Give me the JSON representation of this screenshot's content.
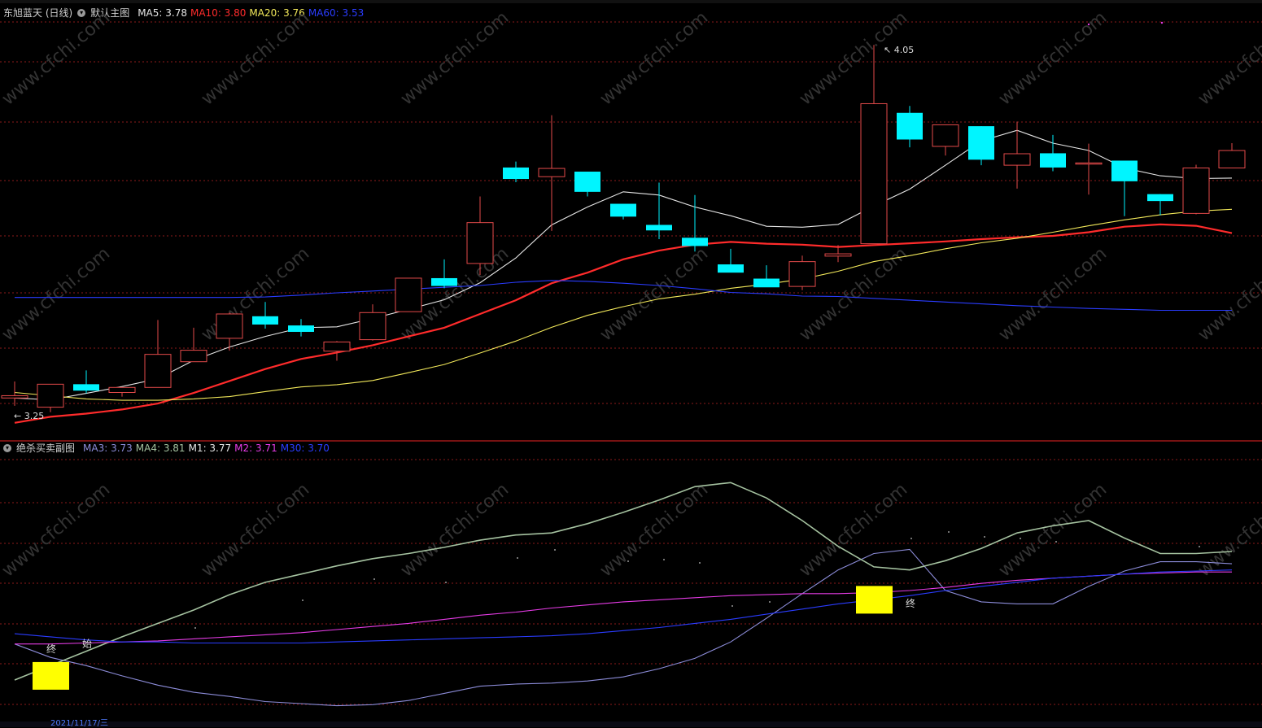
{
  "main_panel": {
    "title": "东旭蓝天 (日线)",
    "indicator_name": "默认主图",
    "legend": [
      {
        "label": "MA5:",
        "value": "3.78",
        "color": "#e6e6e6"
      },
      {
        "label": "MA10:",
        "value": "3.80",
        "color": "#ff2b2b"
      },
      {
        "label": "MA20:",
        "value": "3.76",
        "color": "#f2e85a"
      },
      {
        "label": "MA60:",
        "value": "3.53",
        "color": "#2a3cff"
      }
    ],
    "high_label": "4.05",
    "low_label": "3.25"
  },
  "sub_panel": {
    "indicator_name": "绝杀买卖副图",
    "legend": [
      {
        "label": "MA3:",
        "value": "3.73",
        "color": "#8c8cd9"
      },
      {
        "label": "MA4:",
        "value": "3.81",
        "color": "#a5c2a0"
      },
      {
        "label": "M1:",
        "value": "3.77",
        "color": "#e6e6e6"
      },
      {
        "label": "M2:",
        "value": "3.71",
        "color": "#e53be5"
      },
      {
        "label": "M30:",
        "value": "3.70",
        "color": "#2a3cff"
      }
    ],
    "markers": [
      {
        "text": "终",
        "x": 1,
        "y": 3.665
      },
      {
        "text": "始",
        "x": 2,
        "y": 3.67
      },
      {
        "text": "终",
        "x": 25,
        "y": 3.709
      }
    ]
  },
  "bottom_bar": {
    "date_label": "2021/11/17/三"
  },
  "watermark": "www.cfchi.com",
  "colors": {
    "up": "#e34a4a",
    "down": "#00f5ff",
    "grid": "#8b1a1a",
    "signal": "#ffff00"
  },
  "chart_data": [
    {
      "type": "candlestick",
      "title": "东旭蓝天 (日线)",
      "ylim": [
        3.2,
        4.1
      ],
      "candles": [
        {
          "o": 3.281,
          "h": 3.317,
          "l": 3.264,
          "c": 3.286
        },
        {
          "o": 3.261,
          "h": 3.311,
          "l": 3.25,
          "c": 3.311
        },
        {
          "o": 3.311,
          "h": 3.341,
          "l": 3.291,
          "c": 3.297
        },
        {
          "o": 3.293,
          "h": 3.304,
          "l": 3.284,
          "c": 3.304
        },
        {
          "o": 3.304,
          "h": 3.451,
          "l": 3.304,
          "c": 3.376
        },
        {
          "o": 3.36,
          "h": 3.434,
          "l": 3.36,
          "c": 3.385
        },
        {
          "o": 3.411,
          "h": 3.467,
          "l": 3.384,
          "c": 3.464
        },
        {
          "o": 3.459,
          "h": 3.49,
          "l": 3.432,
          "c": 3.441
        },
        {
          "o": 3.439,
          "h": 3.453,
          "l": 3.415,
          "c": 3.425
        },
        {
          "o": 3.383,
          "h": 3.405,
          "l": 3.362,
          "c": 3.403
        },
        {
          "o": 3.408,
          "h": 3.485,
          "l": 3.406,
          "c": 3.467
        },
        {
          "o": 3.469,
          "h": 3.542,
          "l": 3.469,
          "c": 3.542
        },
        {
          "o": 3.542,
          "h": 3.583,
          "l": 3.52,
          "c": 3.525
        },
        {
          "o": 3.574,
          "h": 3.72,
          "l": 3.549,
          "c": 3.663
        },
        {
          "o": 3.783,
          "h": 3.796,
          "l": 3.751,
          "c": 3.758
        },
        {
          "o": 3.763,
          "h": 3.897,
          "l": 3.645,
          "c": 3.781
        },
        {
          "o": 3.774,
          "h": 3.774,
          "l": 3.72,
          "c": 3.73
        },
        {
          "o": 3.704,
          "h": 3.704,
          "l": 3.67,
          "c": 3.676
        },
        {
          "o": 3.658,
          "h": 3.75,
          "l": 3.627,
          "c": 3.646
        },
        {
          "o": 3.63,
          "h": 3.723,
          "l": 3.6,
          "c": 3.612
        },
        {
          "o": 3.572,
          "h": 3.606,
          "l": 3.563,
          "c": 3.554
        },
        {
          "o": 3.541,
          "h": 3.57,
          "l": 3.525,
          "c": 3.522
        },
        {
          "o": 3.524,
          "h": 3.591,
          "l": 3.516,
          "c": 3.578
        },
        {
          "o": 3.59,
          "h": 3.614,
          "l": 3.577,
          "c": 3.595
        },
        {
          "o": 3.617,
          "h": 4.05,
          "l": 3.617,
          "c": 3.922
        },
        {
          "o": 3.902,
          "h": 3.917,
          "l": 3.827,
          "c": 3.844
        },
        {
          "o": 3.829,
          "h": 3.874,
          "l": 3.809,
          "c": 3.876
        },
        {
          "o": 3.873,
          "h": 3.873,
          "l": 3.788,
          "c": 3.8
        },
        {
          "o": 3.788,
          "h": 3.883,
          "l": 3.737,
          "c": 3.813
        },
        {
          "o": 3.814,
          "h": 3.854,
          "l": 3.775,
          "c": 3.783
        },
        {
          "o": 3.793,
          "h": 3.835,
          "l": 3.724,
          "c": 3.793
        },
        {
          "o": 3.798,
          "h": 3.798,
          "l": 3.677,
          "c": 3.753
        },
        {
          "o": 3.725,
          "h": 3.725,
          "l": 3.679,
          "c": 3.71
        },
        {
          "o": 3.683,
          "h": 3.789,
          "l": 3.681,
          "c": 3.782
        },
        {
          "o": 3.782,
          "h": 3.836,
          "l": 3.782,
          "c": 3.82
        }
      ],
      "series": [
        {
          "name": "MA5",
          "color": "#e6e6e6",
          "values": [
            3.281,
            3.277,
            3.291,
            3.306,
            3.323,
            3.363,
            3.392,
            3.415,
            3.434,
            3.436,
            3.454,
            3.474,
            3.495,
            3.532,
            3.586,
            3.658,
            3.697,
            3.73,
            3.723,
            3.697,
            3.678,
            3.655,
            3.653,
            3.659,
            3.699,
            3.736,
            3.788,
            3.841,
            3.864,
            3.836,
            3.82,
            3.782,
            3.765,
            3.759,
            3.76
          ]
        },
        {
          "name": "MA10",
          "color": "#ff2b2b",
          "values": [
            3.227,
            3.24,
            3.247,
            3.256,
            3.269,
            3.292,
            3.318,
            3.344,
            3.366,
            3.38,
            3.396,
            3.415,
            3.434,
            3.464,
            3.494,
            3.531,
            3.554,
            3.583,
            3.602,
            3.615,
            3.621,
            3.617,
            3.615,
            3.61,
            3.614,
            3.618,
            3.622,
            3.627,
            3.631,
            3.634,
            3.642,
            3.654,
            3.659,
            3.656,
            3.64
          ]
        },
        {
          "name": "MA20",
          "color": "#f2e85a",
          "values": [
            3.293,
            3.286,
            3.279,
            3.276,
            3.276,
            3.279,
            3.284,
            3.295,
            3.305,
            3.31,
            3.319,
            3.336,
            3.354,
            3.379,
            3.405,
            3.435,
            3.461,
            3.48,
            3.497,
            3.507,
            3.52,
            3.529,
            3.54,
            3.557,
            3.578,
            3.591,
            3.606,
            3.619,
            3.629,
            3.642,
            3.656,
            3.669,
            3.68,
            3.688,
            3.692
          ]
        },
        {
          "name": "MA60",
          "color": "#2a3cff",
          "values": [
            3.5,
            3.5,
            3.5,
            3.5,
            3.5,
            3.5,
            3.5,
            3.501,
            3.505,
            3.51,
            3.514,
            3.518,
            3.522,
            3.526,
            3.533,
            3.537,
            3.535,
            3.531,
            3.526,
            3.519,
            3.511,
            3.508,
            3.503,
            3.502,
            3.498,
            3.494,
            3.49,
            3.486,
            3.482,
            3.479,
            3.476,
            3.474,
            3.472,
            3.472,
            3.472
          ]
        }
      ]
    },
    {
      "type": "line",
      "title": "绝杀买卖副图",
      "ylim": [
        3.6,
        3.85
      ],
      "series": [
        {
          "name": "MA3",
          "color": "#8c8cd9",
          "values": [
            3.673,
            3.66,
            3.652,
            3.642,
            3.633,
            3.626,
            3.622,
            3.617,
            3.615,
            3.613,
            3.614,
            3.618,
            3.625,
            3.632,
            3.634,
            3.635,
            3.637,
            3.641,
            3.649,
            3.659,
            3.675,
            3.698,
            3.722,
            3.745,
            3.761,
            3.765,
            3.725,
            3.714,
            3.712,
            3.712,
            3.729,
            3.744,
            3.753,
            3.753,
            3.751
          ]
        },
        {
          "name": "MA4",
          "color": "#a5c2a0",
          "values": [
            3.638,
            3.652,
            3.666,
            3.68,
            3.693,
            3.706,
            3.721,
            3.733,
            3.741,
            3.749,
            3.756,
            3.761,
            3.767,
            3.774,
            3.779,
            3.781,
            3.79,
            3.801,
            3.813,
            3.826,
            3.83,
            3.815,
            3.793,
            3.768,
            3.748,
            3.745,
            3.754,
            3.766,
            3.781,
            3.788,
            3.793,
            3.776,
            3.761,
            3.761,
            3.763
          ]
        },
        {
          "name": "M1",
          "color": "#e6e6e6",
          "values": []
        },
        {
          "name": "M2",
          "color": "#e53be5",
          "values": [
            3.673,
            3.673,
            3.674,
            3.675,
            3.676,
            3.678,
            3.68,
            3.682,
            3.684,
            3.687,
            3.69,
            3.693,
            3.697,
            3.701,
            3.704,
            3.708,
            3.711,
            3.714,
            3.716,
            3.718,
            3.72,
            3.721,
            3.722,
            3.722,
            3.723,
            3.725,
            3.728,
            3.732,
            3.735,
            3.737,
            3.739,
            3.741,
            3.742,
            3.743,
            3.743
          ]
        },
        {
          "name": "M30",
          "color": "#2a3cff",
          "values": [
            3.683,
            3.68,
            3.677,
            3.675,
            3.675,
            3.674,
            3.674,
            3.674,
            3.674,
            3.675,
            3.676,
            3.677,
            3.678,
            3.679,
            3.68,
            3.681,
            3.683,
            3.686,
            3.689,
            3.693,
            3.697,
            3.702,
            3.707,
            3.712,
            3.716,
            3.72,
            3.725,
            3.729,
            3.733,
            3.737,
            3.739,
            3.741,
            3.743,
            3.744,
            3.745
          ]
        }
      ],
      "signals": [
        {
          "x": 1,
          "y": 3.642
        },
        {
          "x": 24,
          "y": 3.716
        }
      ]
    }
  ]
}
